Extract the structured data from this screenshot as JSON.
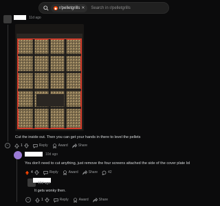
{
  "search": {
    "community_chip": "r/pelletgrills",
    "placeholder": "Search in r/pelletgrills"
  },
  "comments": [
    {
      "age": "11d ago",
      "text": "Cut the inside out. Then you can get your hands in there to level the pellets",
      "votes": "1",
      "actions": {
        "reply": "Reply",
        "award": "Award",
        "share": "Share"
      }
    },
    {
      "age": "10d ago",
      "text": "You don't need to cut anything, just remove the four screens attached the side of the cover plate lol",
      "votes": "4",
      "actions": {
        "reply": "Reply",
        "award": "Award",
        "share": "Share",
        "more_count": "42"
      }
    },
    {
      "age": "10d ago",
      "text": "It gets wonky then.",
      "votes": "1",
      "actions": {
        "reply": "Reply",
        "award": "Award",
        "share": "Share"
      }
    }
  ],
  "colors": {
    "background": "#0b0b0c",
    "upvote_active": "#ff4500",
    "tray_red": "#d43b2a"
  },
  "icons": [
    "search-icon",
    "reddit-icon",
    "close-icon",
    "upvote-icon",
    "downvote-icon",
    "reply-icon",
    "award-icon",
    "share-icon",
    "chat-icon",
    "collapse-icon"
  ]
}
